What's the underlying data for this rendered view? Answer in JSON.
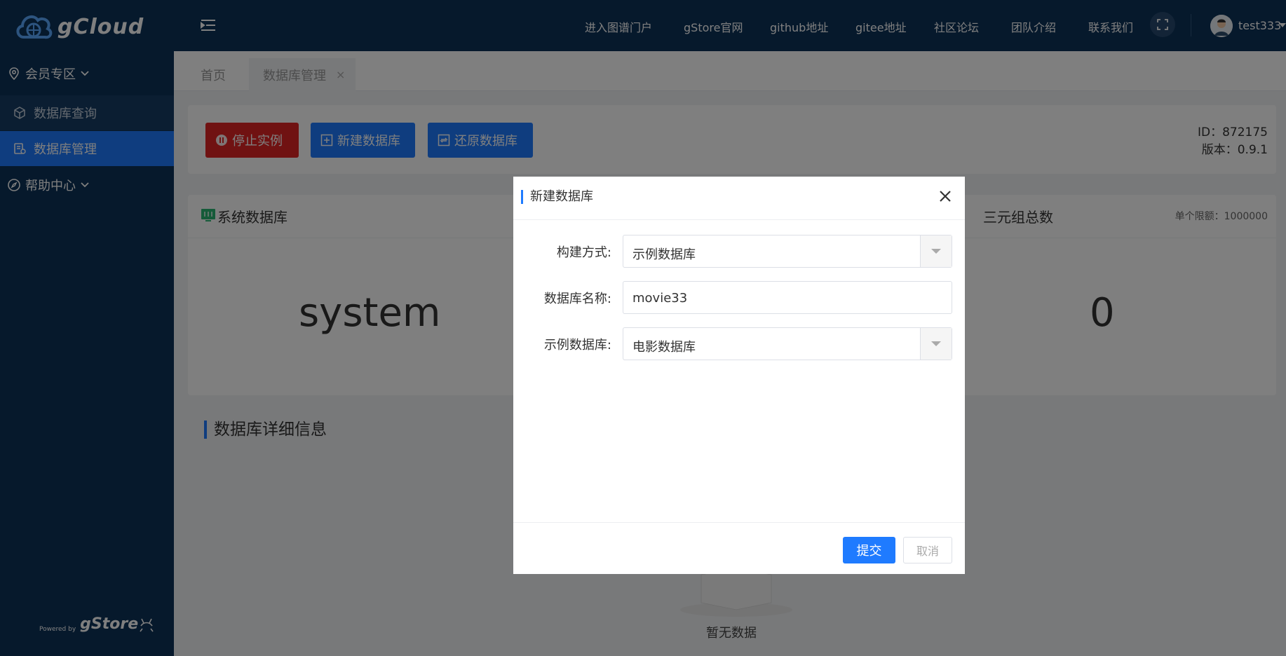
{
  "app": {
    "logo_text": "gCloud",
    "powered_by": "Powered by",
    "footer_brand": "gStore"
  },
  "sidebar": {
    "groups": [
      {
        "label": "会员专区",
        "icon": "location-pin-icon"
      },
      {
        "label": "帮助中心",
        "icon": "compass-icon"
      }
    ],
    "items": [
      {
        "label": "数据库查询",
        "icon": "cube-icon",
        "active": false
      },
      {
        "label": "数据库管理",
        "icon": "database-settings-icon",
        "active": true
      }
    ]
  },
  "header": {
    "nav": [
      "进入图谱门户",
      "gStore官网",
      "github地址",
      "gitee地址",
      "社区论坛",
      "团队介绍",
      "联系我们"
    ],
    "username": "test333"
  },
  "tabs": [
    {
      "label": "首页",
      "active": false
    },
    {
      "label": "数据库管理",
      "active": true,
      "close": "×"
    }
  ],
  "toolbar": {
    "stop_label": "停止实例",
    "new_label": "新建数据库",
    "restore_label": "还原数据库",
    "id_text": "ID：872175",
    "version_text": "版本：0.9.1"
  },
  "stats": {
    "system_title": "系统数据库",
    "system_value": "system",
    "triples_title": "三元组总数",
    "triples_limit": "单个限额：1000000",
    "triples_value": "0"
  },
  "detail": {
    "title": "数据库详细信息",
    "empty_text": "暂无数据"
  },
  "modal": {
    "title": "新建数据库",
    "fields": [
      {
        "label": "构建方式:",
        "value": "示例数据库",
        "type": "select"
      },
      {
        "label": "数据库名称:",
        "value": "movie33",
        "type": "input"
      },
      {
        "label": "示例数据库:",
        "value": "电影数据库",
        "type": "select"
      }
    ],
    "submit_label": "提交",
    "cancel_label": "取消"
  },
  "colors": {
    "sidebar_bg": "#0d3258",
    "primary": "#1f7bff",
    "danger": "#e02424"
  }
}
